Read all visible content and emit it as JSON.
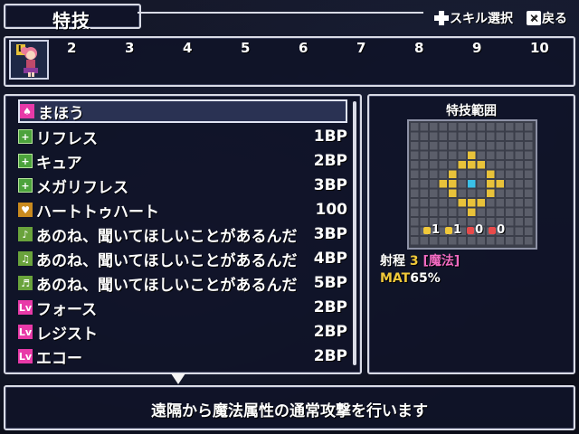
{
  "header": {
    "title": "特技",
    "hint_skill": "スキル選択",
    "hint_back": "戻る",
    "x_glyph": "✕"
  },
  "party": {
    "leader_tag": "L",
    "slots": [
      "2",
      "3",
      "4",
      "5",
      "6",
      "7",
      "8",
      "9",
      "10"
    ]
  },
  "skills": [
    {
      "icon": "magic-book-icon",
      "name": "まほう",
      "cost": ""
    },
    {
      "icon": "heal-plus-icon",
      "name": "リフレス",
      "cost": "1BP"
    },
    {
      "icon": "heal-plus-icon",
      "name": "キュア",
      "cost": "2BP"
    },
    {
      "icon": "heal-plus-icon",
      "name": "メガリフレス",
      "cost": "3BP"
    },
    {
      "icon": "heart-icon",
      "name": "ハートトゥハート",
      "cost": "100"
    },
    {
      "icon": "music-note-icon",
      "name": "あのね、聞いてほしいことがあるんだ",
      "cost": "3BP"
    },
    {
      "icon": "music-note-icon",
      "name": "あのね、聞いてほしいことがあるんだ",
      "cost": "4BP"
    },
    {
      "icon": "music-note-icon",
      "name": "あのね、聞いてほしいことがあるんだ",
      "cost": "5BP"
    },
    {
      "icon": "level-icon",
      "name": "フォース",
      "cost": "2BP"
    },
    {
      "icon": "level-icon",
      "name": "レジスト",
      "cost": "2BP"
    },
    {
      "icon": "level-icon",
      "name": "エコー",
      "cost": "2BP"
    }
  ],
  "range": {
    "title": "特技範囲",
    "stats": [
      "1",
      "1",
      "0",
      "0"
    ],
    "label": "射程",
    "value": "3",
    "type": "[魔法]",
    "mat_label": "MAT",
    "mat_value": "65%"
  },
  "description": "遠隔から魔法属性の通常攻撃を行います",
  "colors": {
    "panel_bg": "#10142a",
    "border": "#d9dbe6",
    "highlight_yellow": "#f0c83a",
    "magic_pink": "#f06ac0",
    "grid_cell": "#5b5e6a",
    "range_yellow": "#e8c23a",
    "range_center": "#3ac0e8"
  }
}
